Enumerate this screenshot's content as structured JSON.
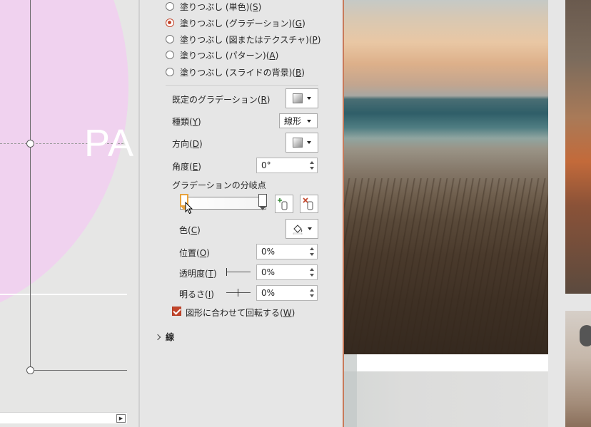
{
  "canvas": {
    "slide_text": "PA"
  },
  "fill_options": [
    {
      "label": "塗りつぶし (単色)(",
      "key": "S",
      "suffix": ")",
      "selected": false
    },
    {
      "label": "塗りつぶし (グラデーション)(",
      "key": "G",
      "suffix": ")",
      "selected": true
    },
    {
      "label": "塗りつぶし (図またはテクスチャ)(",
      "key": "P",
      "suffix": ")",
      "selected": false
    },
    {
      "label": "塗りつぶし (パターン)(",
      "key": "A",
      "suffix": ")",
      "selected": false
    },
    {
      "label": "塗りつぶし (スライドの背景)(",
      "key": "B",
      "suffix": ")",
      "selected": false
    }
  ],
  "preset": {
    "label": "既定のグラデーション(",
    "key": "R",
    "suffix": ")"
  },
  "type": {
    "label": "種類(",
    "key": "Y",
    "suffix": ")",
    "value": "線形"
  },
  "direction": {
    "label": "方向(",
    "key": "D",
    "suffix": ")"
  },
  "angle": {
    "label": "角度(",
    "key": "E",
    "suffix": ")",
    "value": "0°"
  },
  "stops_title": "グラデーションの分岐点",
  "color": {
    "label": "色(",
    "key": "C",
    "suffix": ")"
  },
  "position": {
    "label": "位置(",
    "key": "O",
    "suffix": ")",
    "value": "0%"
  },
  "transparency": {
    "label": "透明度(",
    "key": "T",
    "suffix": ")",
    "value": "0%"
  },
  "brightness": {
    "label": "明るさ(",
    "key": "I",
    "suffix": ")",
    "value": "0%"
  },
  "rotate_with_shape": {
    "label": "図形に合わせて回転する(",
    "key": "W",
    "suffix": ")",
    "checked": true
  },
  "line_section": "線",
  "colors": {
    "accent": "#c2452b",
    "active_stop": "#e8a33d",
    "slide_pink": "#f0d2ef"
  },
  "icons": [
    "cursor-arrow-icon",
    "add-stop-icon",
    "remove-stop-icon",
    "paint-bucket-icon",
    "chevron-right-icon"
  ]
}
